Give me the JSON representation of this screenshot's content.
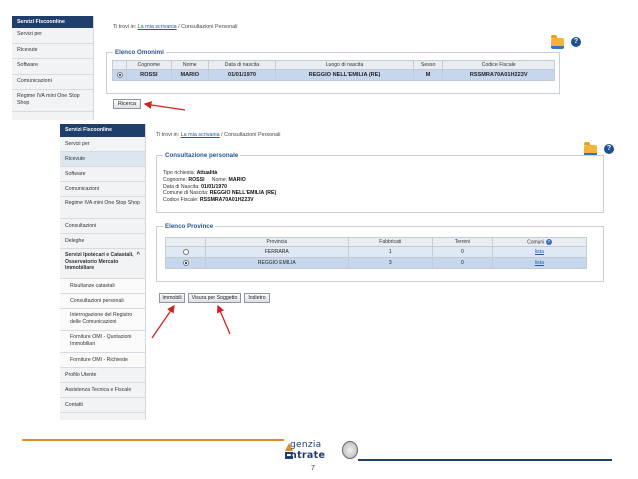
{
  "shot1": {
    "sidebar": {
      "title": "Servizi Fiscoonline",
      "items": [
        "Servizi per",
        "Ricevute",
        "Software",
        "Comunicazioni",
        "Regime IVA mini One Stop Shop"
      ]
    },
    "breadcrumb": {
      "prefix": "Ti trovi in:",
      "link": "La mia scrivania",
      "sep": "/",
      "current": "Consultazioni Personali"
    },
    "elenco": {
      "legend": "Elenco Omonimi",
      "headers": [
        "",
        "Cognome",
        "Nome",
        "Data di nascita",
        "Luogo di nascita",
        "Sesso",
        "Codice Fiscale"
      ],
      "row": [
        "ROSSI",
        "MARIO",
        "01/01/1970",
        "REGGIO NELL'EMILIA (RE)",
        "M",
        "RSSMRA70A01H223V"
      ]
    },
    "ricerca_label": "Ricerca"
  },
  "shot2": {
    "sidebar": {
      "title": "Servizi Fiscoonline",
      "items": [
        "Servizi per",
        "Ricevute",
        "Software",
        "Comunicazioni",
        "Regime IVA mini One Stop Shop",
        "Consultazioni",
        "Deleghe",
        "Servizi Ipotecari e Catastali, Osservatorio Mercato Immobiliare",
        "Risultanze catastali",
        "Consultazioni personali",
        "Interrogazione del Registro delle Comunicazioni",
        "Forniture OMI - Quotazioni Immobiliari",
        "Forniture OMI - Richieste",
        "Profilo Utente",
        "Assistenza Tecnica e Fiscale",
        "Contatti"
      ]
    },
    "breadcrumb": {
      "prefix": "Ti trovi in:",
      "link": "La mia scrivania",
      "sep": "/",
      "current": "Consultazioni Personali"
    },
    "personale": {
      "legend": "Consultazione personale",
      "tipo_label": "Tipo richiesta:",
      "tipo": "Attualità",
      "cognome_label": "Cognome:",
      "cognome": "ROSSI",
      "nome_label": "Nome:",
      "nome": "MARIO",
      "data_label": "Data di Nascita:",
      "data": "01/01/1970",
      "comune_label": "Comune di Nascita:",
      "comune": "REGGIO NELL'EMILIA (RE)",
      "cf_label": "Codice Fiscale:",
      "cf": "RSSMRA70A01H223V"
    },
    "province": {
      "legend": "Elenco Province",
      "headers": [
        "",
        "Provincia",
        "Fabbricati",
        "Terreni",
        "Comuni"
      ],
      "rows": [
        {
          "provincia": "FERRARA",
          "fabbricati": "1",
          "terreni": "0",
          "comuni": "lista",
          "selected": false
        },
        {
          "provincia": "REGGIO EMILIA",
          "fabbricati": "3",
          "terreni": "0",
          "comuni": "lista",
          "selected": true
        }
      ]
    },
    "buttons": {
      "immobili": "Immobili",
      "visura": "Visura per Soggetto",
      "indietro": "Indietro"
    }
  },
  "footer": {
    "logo_line1": "genzia",
    "logo_line2": "ntrate",
    "page": "7"
  },
  "colors": {
    "nav_dark": "#1f3e6b",
    "accent_orange": "#e08a2e",
    "annotation_red": "#d62020",
    "link": "#1e58a8"
  },
  "icons": [
    "folder-icon",
    "help-icon",
    "annotation-arrow"
  ]
}
